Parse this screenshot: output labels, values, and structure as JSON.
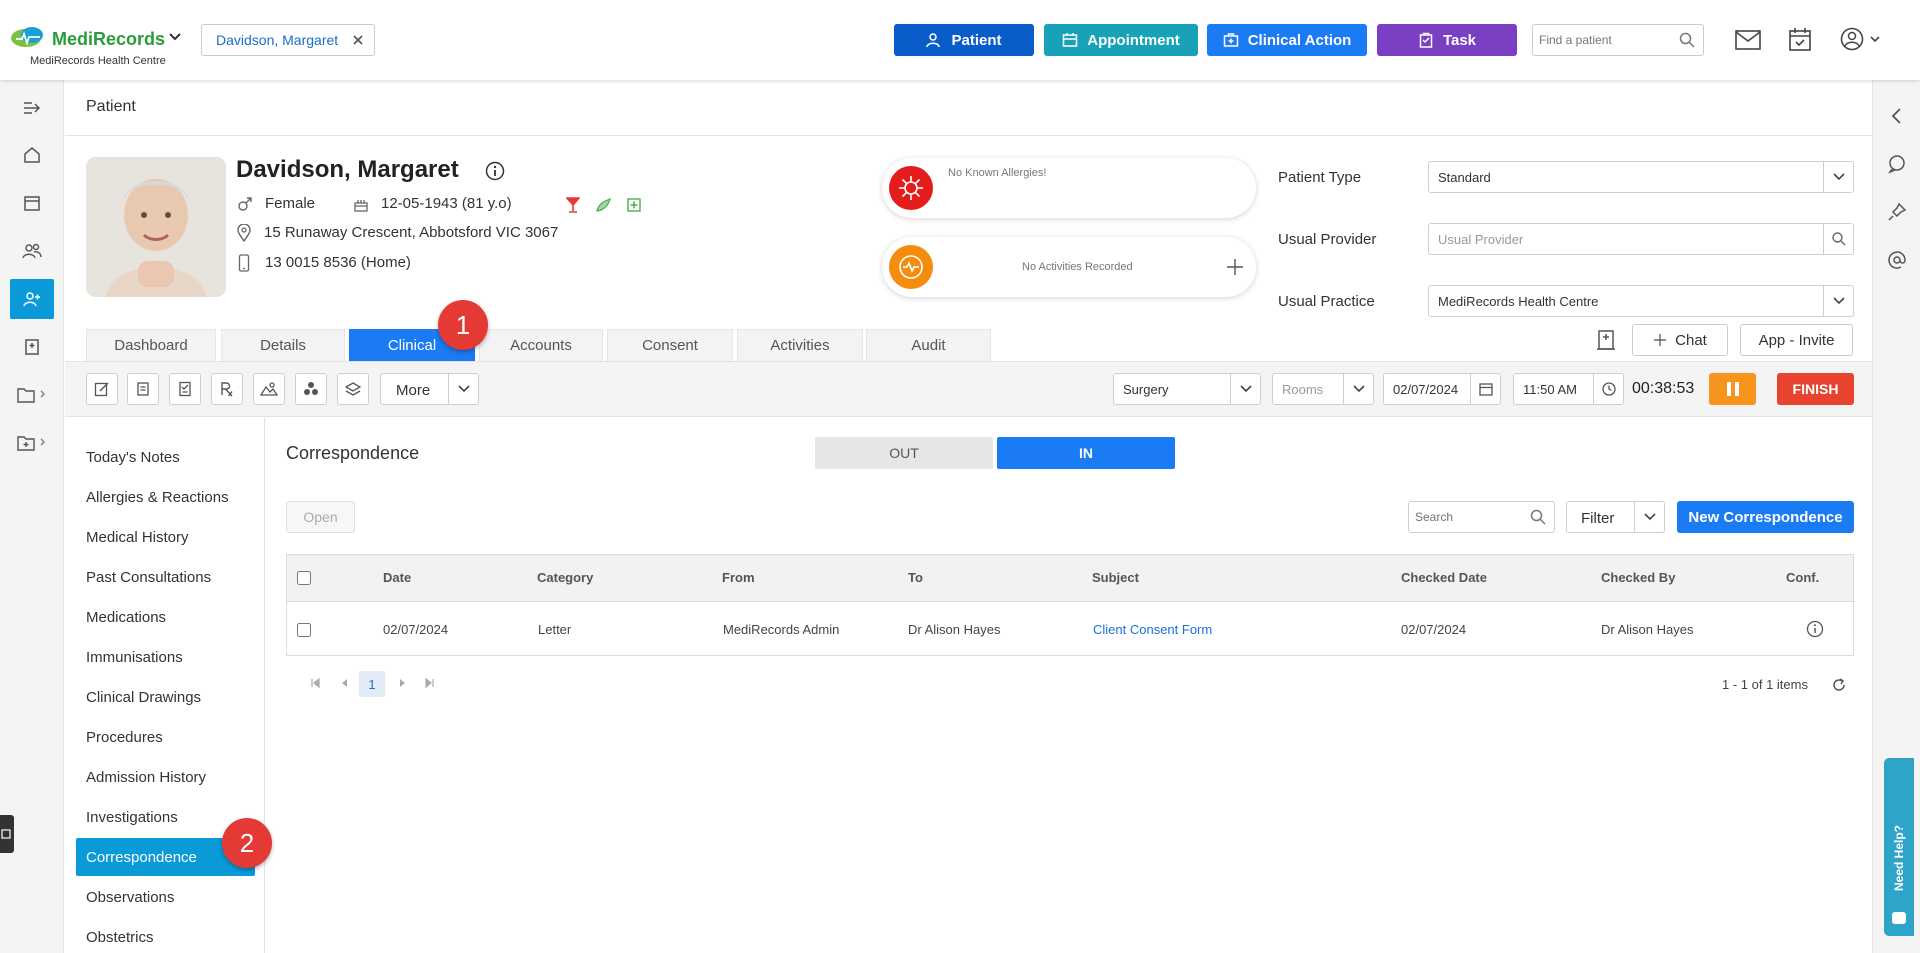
{
  "header": {
    "brand_name": "MediRecords",
    "practice_name": "MediRecords Health Centre",
    "open_patient_tab": "Davidson, Margaret",
    "buttons": {
      "patient": "Patient",
      "appointment": "Appointment",
      "clinical_action": "Clinical Action",
      "task": "Task"
    },
    "search_placeholder": "Find a patient",
    "colors": {
      "patient": "#0a5cc8",
      "appointment": "#17a2b8",
      "clinical_action": "#1a7bf2",
      "task": "#7b3fc4"
    }
  },
  "page_title": "Patient",
  "patient": {
    "name": "Davidson, Margaret",
    "gender": "Female",
    "dob": "12-05-1943 (81 y.o)",
    "address": "15 Runaway Crescent, Abbotsford VIC 3067",
    "phone": "13 0015 8536 (Home)"
  },
  "alerts": {
    "allergies": "No Known Allergies!",
    "activities": "No Activities Recorded"
  },
  "patient_fields": {
    "patient_type_label": "Patient Type",
    "patient_type_value": "Standard",
    "usual_provider_label": "Usual Provider",
    "usual_provider_placeholder": "Usual Provider",
    "usual_practice_label": "Usual Practice",
    "usual_practice_value": "MediRecords Health Centre"
  },
  "actions": {
    "chat": "Chat",
    "app_invite": "App - Invite"
  },
  "tabs": [
    "Dashboard",
    "Details",
    "Clinical",
    "Accounts",
    "Consent",
    "Activities",
    "Audit"
  ],
  "active_tab": "Clinical",
  "toolbar": {
    "more": "More",
    "location": "Surgery",
    "rooms_placeholder": "Rooms",
    "date": "02/07/2024",
    "time": "11:50 AM",
    "timer": "00:38:53",
    "finish": "FINISH"
  },
  "sidebar": {
    "items": [
      "Today's Notes",
      "Allergies & Reactions",
      "Medical History",
      "Past Consultations",
      "Medications",
      "Immunisations",
      "Clinical Drawings",
      "Procedures",
      "Admission History",
      "Investigations",
      "Correspondence",
      "Observations",
      "Obstetrics"
    ],
    "active": "Correspondence"
  },
  "correspondence": {
    "title": "Correspondence",
    "toggle_out": "OUT",
    "toggle_in": "IN",
    "open_button": "Open",
    "search_placeholder": "Search",
    "filter": "Filter",
    "new_button": "New Correspondence",
    "columns": [
      "Date",
      "Category",
      "From",
      "To",
      "Subject",
      "Checked Date",
      "Checked By",
      "Conf."
    ],
    "rows": [
      {
        "date": "02/07/2024",
        "category": "Letter",
        "from": "MediRecords Admin",
        "to": "Dr Alison Hayes",
        "subject": "Client Consent Form",
        "checked_date": "02/07/2024",
        "checked_by": "Dr Alison Hayes"
      }
    ],
    "current_page": "1",
    "items_summary": "1 - 1 of 1 items"
  },
  "annotations": {
    "step1": "1",
    "step2": "2"
  },
  "help_tab": "Need Help?"
}
